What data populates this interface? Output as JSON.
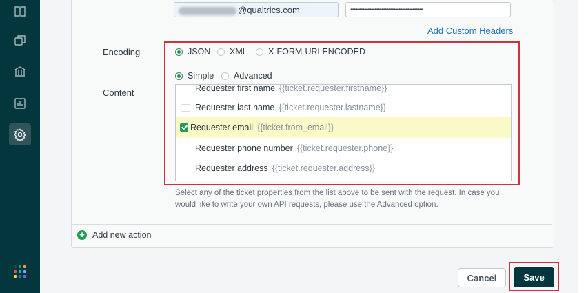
{
  "sidebar": {
    "items": [
      {
        "icon": "book-icon",
        "active": false
      },
      {
        "icon": "copy-icon",
        "active": false
      },
      {
        "icon": "library-icon",
        "active": false
      },
      {
        "icon": "chart-icon",
        "active": false
      },
      {
        "icon": "gear-icon",
        "active": true
      }
    ],
    "apps_icon": "grid-icon",
    "apps_colors": [
      "#17494d",
      "#1f9d55",
      "#f79a3e",
      "#eb4962",
      "#30aabc",
      "#5ebbde",
      "#ffd424",
      "#1f73b7",
      "#9358d4"
    ]
  },
  "auth": {
    "email_suffix": "@qualtrics.com",
    "password_mask": "••••••••••••••••••••••••••••••••••••••••••"
  },
  "add_headers_link": "Add Custom Headers",
  "encoding": {
    "label": "Encoding",
    "options": [
      {
        "label": "JSON",
        "selected": true
      },
      {
        "label": "XML",
        "selected": false
      },
      {
        "label": "X-FORM-URLENCODED",
        "selected": false
      }
    ]
  },
  "content": {
    "label": "Content",
    "modes": [
      {
        "label": "Simple",
        "selected": true
      },
      {
        "label": "Advanced",
        "selected": false
      }
    ],
    "properties": [
      {
        "label": "Requester first name",
        "placeholder": "{{ticket.requester.firstname}}",
        "checked": false
      },
      {
        "label": "Requester last name",
        "placeholder": "{{ticket.requester.lastname}}",
        "checked": false
      },
      {
        "label": "Requester email",
        "placeholder": "{{ticket.from_email}}",
        "checked": true
      },
      {
        "label": "Requester phone number",
        "placeholder": "{{ticket.requester.phone}}",
        "checked": false
      },
      {
        "label": "Requester address",
        "placeholder": "{{ticket.requester.address}}",
        "checked": false
      }
    ],
    "help_text": "Select any of the ticket properties from the list above to be sent with the request. In case you would like to write your own API requests, please use the Advanced option."
  },
  "add_action": "Add new action",
  "buttons": {
    "cancel": "Cancel",
    "save": "Save"
  },
  "colors": {
    "accent": "#1f73b7",
    "success": "#1f9d55",
    "highlight": "#cc3340",
    "sidebar": "#03363d"
  }
}
